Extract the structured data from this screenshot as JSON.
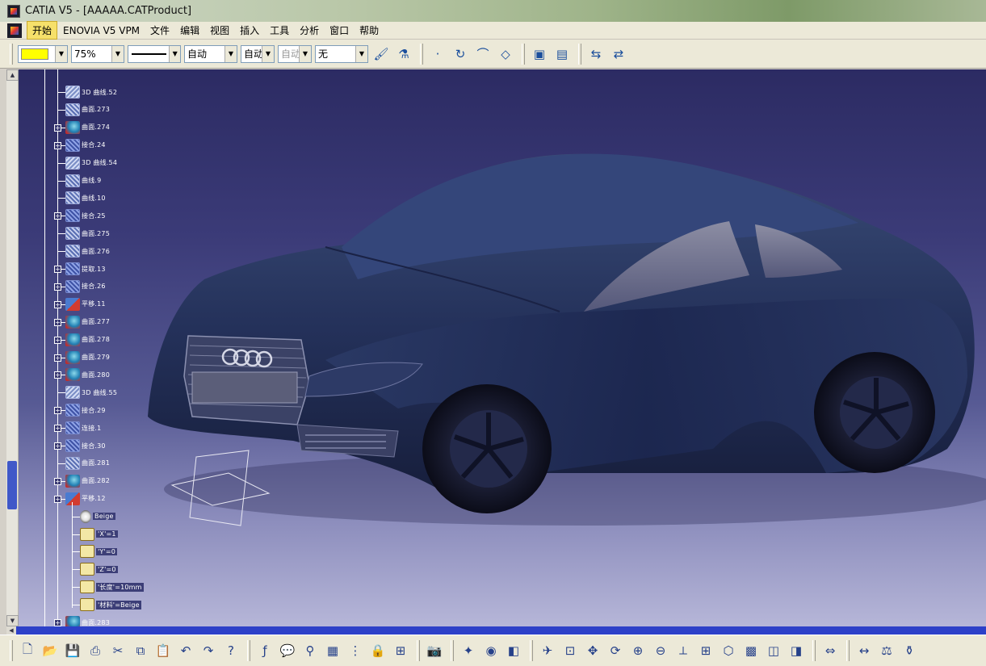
{
  "window": {
    "title": "CATIA V5 - [AAAAA.CATProduct]"
  },
  "menu": {
    "items": [
      "开始",
      "ENOVIA V5 VPM",
      "文件",
      "编辑",
      "视图",
      "插入",
      "工具",
      "分析",
      "窗口",
      "帮助"
    ]
  },
  "toolbar": {
    "color": "#ffff00",
    "transparency": "75%",
    "line_type": "自动",
    "line_weight": "自动",
    "point_style": "自动",
    "layer": "无"
  },
  "tree": {
    "nodes": [
      {
        "label": "3D 曲线.52",
        "icon": "curve3d",
        "plus": false
      },
      {
        "label": "曲面.273",
        "icon": "surf",
        "plus": false
      },
      {
        "label": "曲面.274",
        "icon": "fill",
        "plus": true
      },
      {
        "label": "接合.24",
        "icon": "join",
        "plus": true
      },
      {
        "label": "3D 曲线.54",
        "icon": "curve3d",
        "plus": false
      },
      {
        "label": "曲线.9",
        "icon": "surf",
        "plus": false
      },
      {
        "label": "曲线.10",
        "icon": "surf",
        "plus": false
      },
      {
        "label": "接合.25",
        "icon": "join",
        "plus": true
      },
      {
        "label": "曲面.275",
        "icon": "surf",
        "plus": false
      },
      {
        "label": "曲面.276",
        "icon": "surf",
        "plus": false
      },
      {
        "label": "提取.13",
        "icon": "join",
        "plus": true
      },
      {
        "label": "接合.26",
        "icon": "join",
        "plus": true
      },
      {
        "label": "平移.11",
        "icon": "trans",
        "plus": true
      },
      {
        "label": "曲面.277",
        "icon": "fill",
        "plus": true
      },
      {
        "label": "曲面.278",
        "icon": "fill",
        "plus": true
      },
      {
        "label": "曲面.279",
        "icon": "fill",
        "plus": true
      },
      {
        "label": "曲面.280",
        "icon": "fill",
        "plus": true
      },
      {
        "label": "3D 曲线.55",
        "icon": "curve3d",
        "plus": false
      },
      {
        "label": "接合.29",
        "icon": "join",
        "plus": true
      },
      {
        "label": "连接.1",
        "icon": "join",
        "plus": true
      },
      {
        "label": "接合.30",
        "icon": "join",
        "plus": true
      },
      {
        "label": "曲面.281",
        "icon": "surf",
        "plus": false
      },
      {
        "label": "曲面.282",
        "icon": "fill",
        "plus": true
      },
      {
        "label": "平移.12",
        "icon": "trans",
        "plus": true
      }
    ],
    "children": [
      {
        "label": "Beige",
        "icon": "mat"
      },
      {
        "label": "'X'=1",
        "icon": "param"
      },
      {
        "label": "'Y'=0",
        "icon": "param"
      },
      {
        "label": "'Z'=0",
        "icon": "param"
      },
      {
        "label": "'长度'=10mm",
        "icon": "param"
      },
      {
        "label": "'材料'=Beige",
        "icon": "param"
      }
    ],
    "last": {
      "label": "曲面.283",
      "icon": "fill"
    }
  },
  "car": {
    "body_color": "#1f2a4f",
    "logo": "four-rings-logo"
  }
}
